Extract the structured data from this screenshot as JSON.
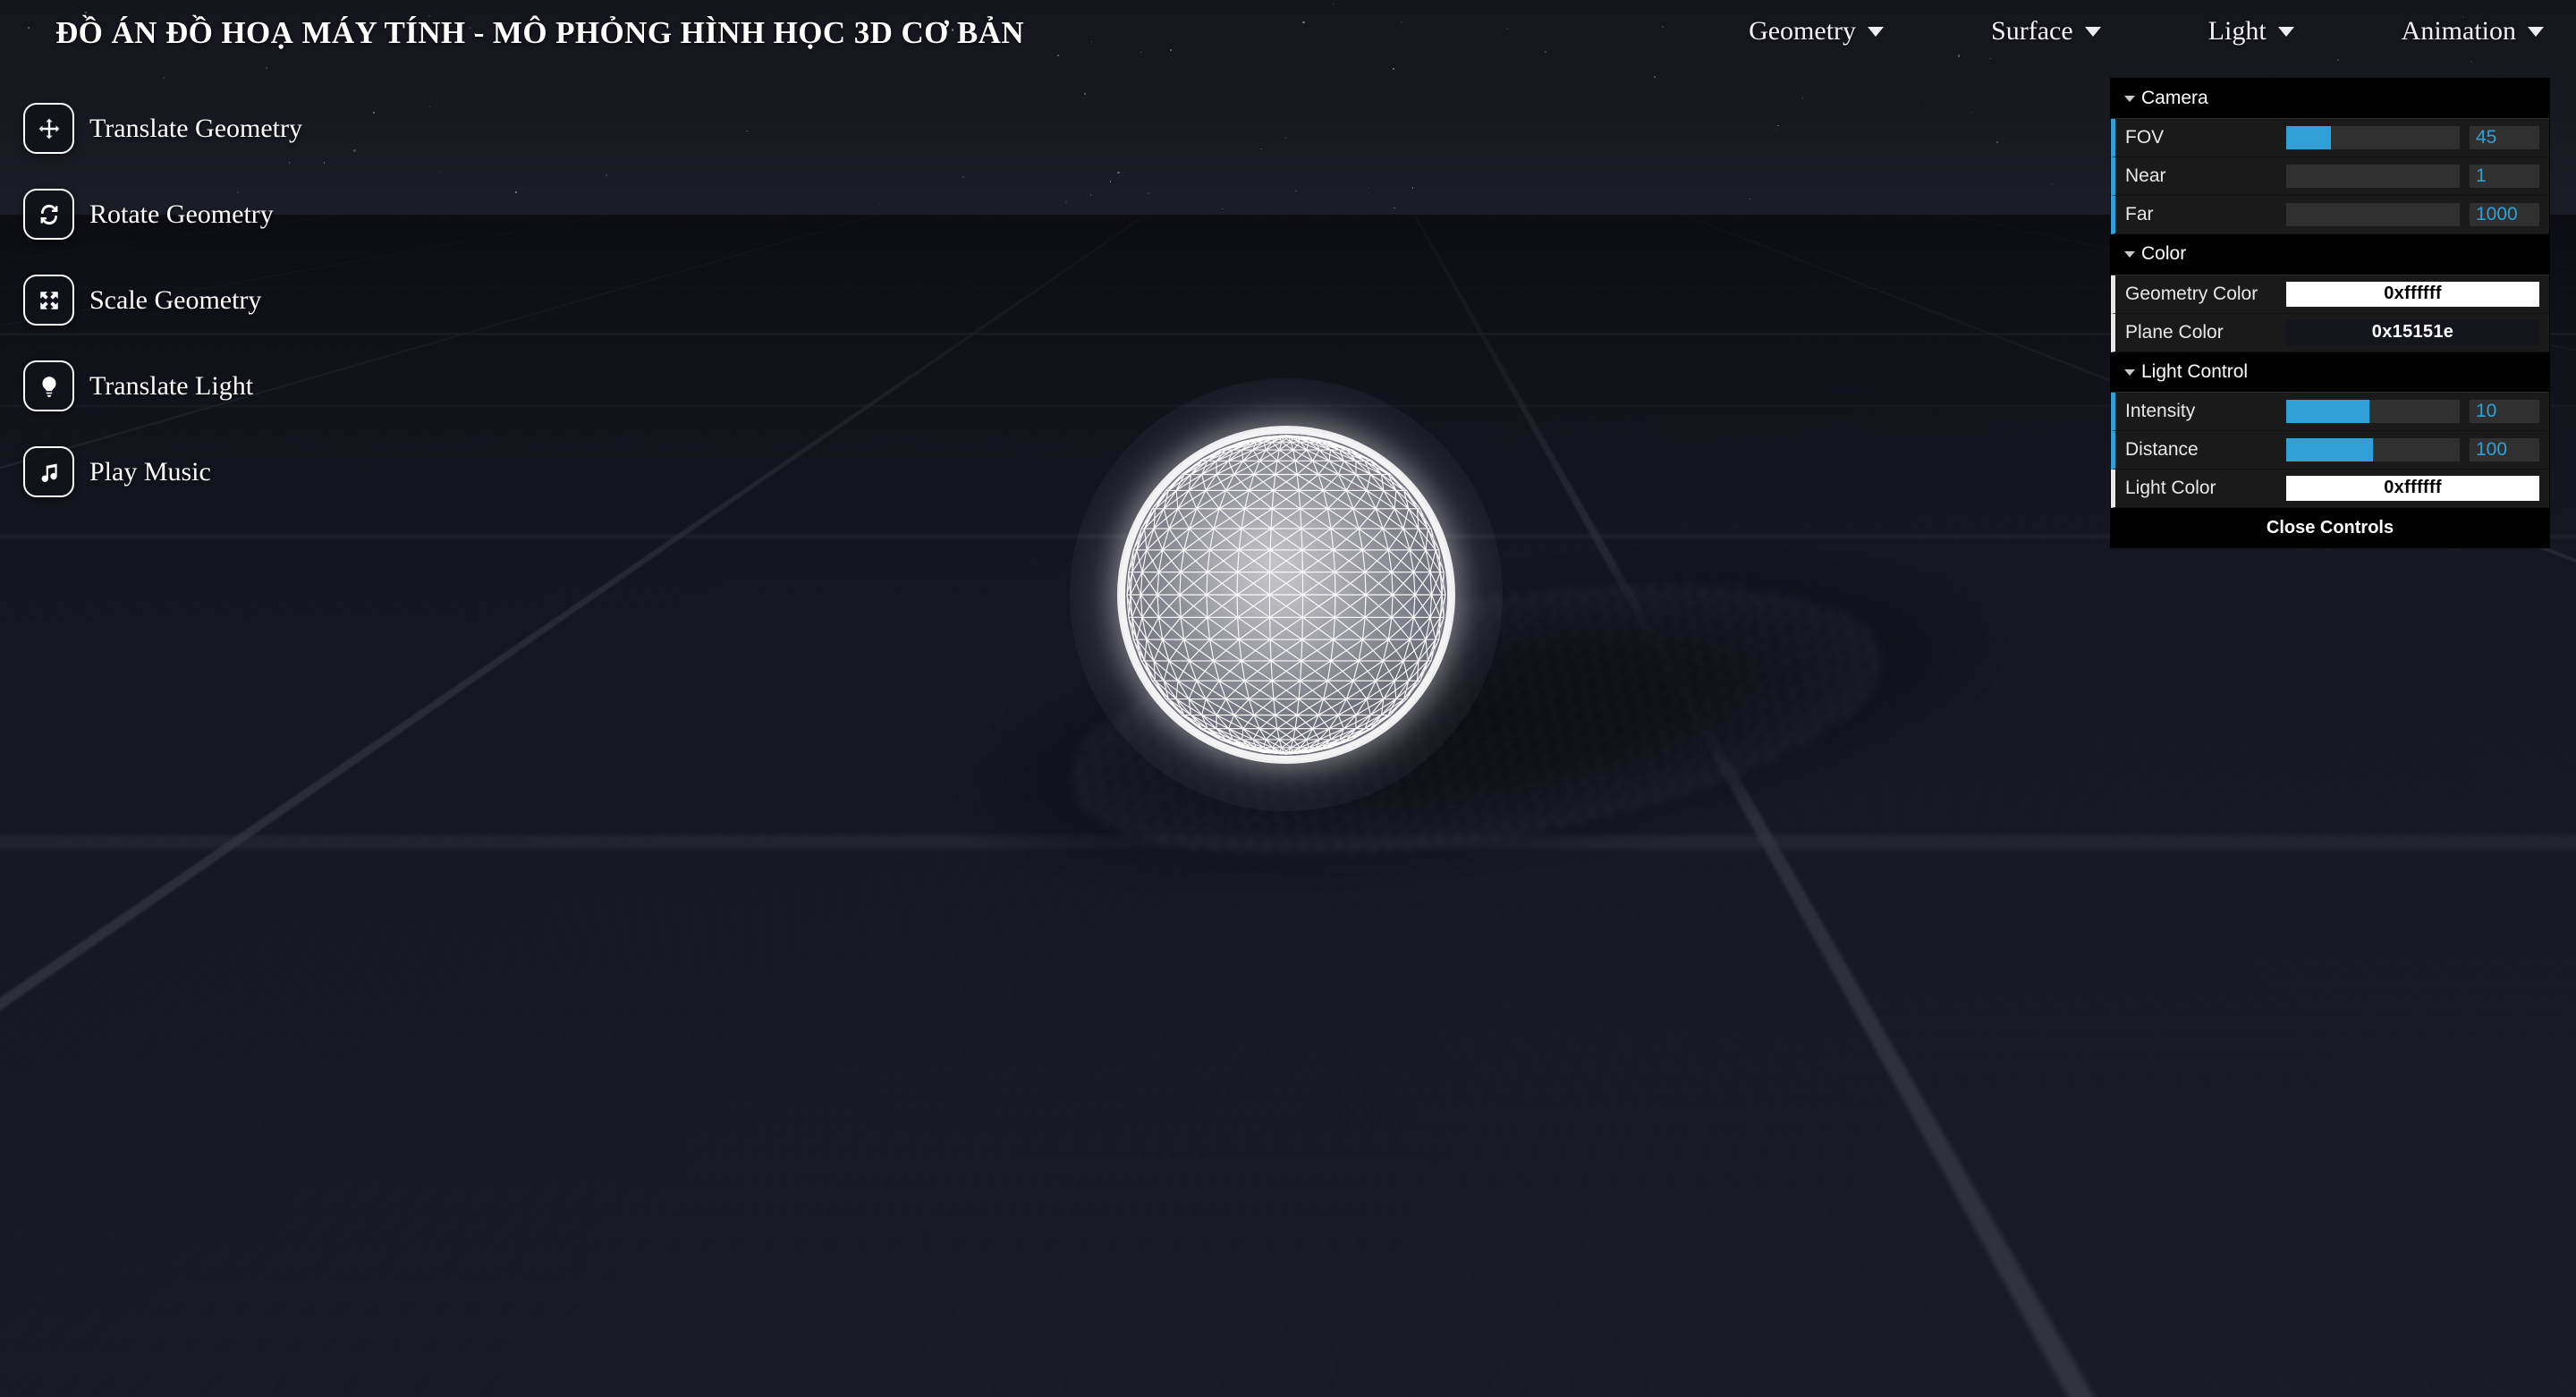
{
  "header": {
    "title": "ĐỒ ÁN ĐỒ HOẠ MÁY TÍNH - MÔ PHỎNG HÌNH HỌC 3D CƠ BẢN",
    "menu": [
      {
        "label": "Geometry",
        "icon": "chevron-down-icon"
      },
      {
        "label": "Surface",
        "icon": "chevron-down-icon"
      },
      {
        "label": "Light",
        "icon": "chevron-down-icon"
      },
      {
        "label": "Animation",
        "icon": "chevron-down-icon"
      }
    ]
  },
  "toolbar": {
    "items": [
      {
        "label": "Translate Geometry",
        "icon": "move-arrows-icon"
      },
      {
        "label": "Rotate Geometry",
        "icon": "refresh-rotate-icon"
      },
      {
        "label": "Scale Geometry",
        "icon": "expand-arrows-icon"
      },
      {
        "label": "Translate Light",
        "icon": "lightbulb-icon"
      },
      {
        "label": "Play Music",
        "icon": "music-note-icon"
      }
    ]
  },
  "gui": {
    "accent_color": "#2fa1d6",
    "folders": [
      {
        "title": "Camera",
        "expanded": true,
        "rows": [
          {
            "type": "slider",
            "label": "FOV",
            "value": "45",
            "fill_percent": 26
          },
          {
            "type": "slider",
            "label": "Near",
            "value": "1",
            "fill_percent": 0
          },
          {
            "type": "slider",
            "label": "Far",
            "value": "1000",
            "fill_percent": 0
          }
        ]
      },
      {
        "title": "Color",
        "expanded": true,
        "rows": [
          {
            "type": "color",
            "label": "Geometry Color",
            "value": "0xffffff",
            "swatch": "#ffffff",
            "text_color": "#000000"
          },
          {
            "type": "color",
            "label": "Plane Color",
            "value": "0x15151e",
            "swatch": "#15151e",
            "text_color": "#ffffff"
          }
        ]
      },
      {
        "title": "Light Control",
        "expanded": true,
        "rows": [
          {
            "type": "slider",
            "label": "Intensity",
            "value": "10",
            "fill_percent": 48
          },
          {
            "type": "slider",
            "label": "Distance",
            "value": "100",
            "fill_percent": 50
          },
          {
            "type": "color",
            "label": "Light Color",
            "value": "0xffffff",
            "swatch": "#ffffff",
            "text_color": "#000000"
          }
        ]
      }
    ],
    "close_label": "Close Controls"
  },
  "scene": {
    "background_color": "#15151e",
    "plane_color": "#15151e",
    "geometry_color": "#ffffff",
    "light_color": "#ffffff",
    "geometry_type": "wireframe-sphere",
    "has_shadow": true,
    "has_grid": true
  }
}
